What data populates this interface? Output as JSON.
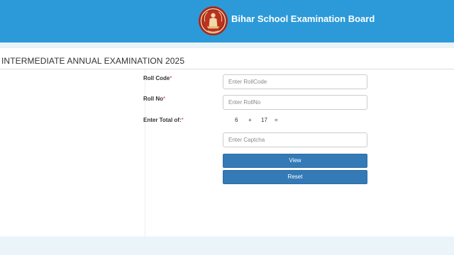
{
  "header": {
    "title": "Bihar School Examination Board",
    "logo_icon": "bseb-emblem-icon",
    "background": "#2c9ad8"
  },
  "form": {
    "heading": "INTERMEDIATE ANNUAL EXAMINATION 2025",
    "roll_code_label": "Roll Code",
    "roll_code_placeholder": "Enter RollCode",
    "roll_code_value": "",
    "roll_no_label": "Roll No",
    "roll_no_placeholder": "Enter RollNo",
    "roll_no_value": "",
    "captcha_label": "Enter Total of:",
    "required_mark": "*",
    "captcha_a": "6",
    "captcha_op": "+",
    "captcha_b": "17",
    "captcha_eq": "=",
    "captcha_placeholder": "Enter Captcha",
    "captcha_value": "",
    "view_label": "View",
    "reset_label": "Reset",
    "button_color": "#337ab7",
    "required_color": "#e03030"
  }
}
